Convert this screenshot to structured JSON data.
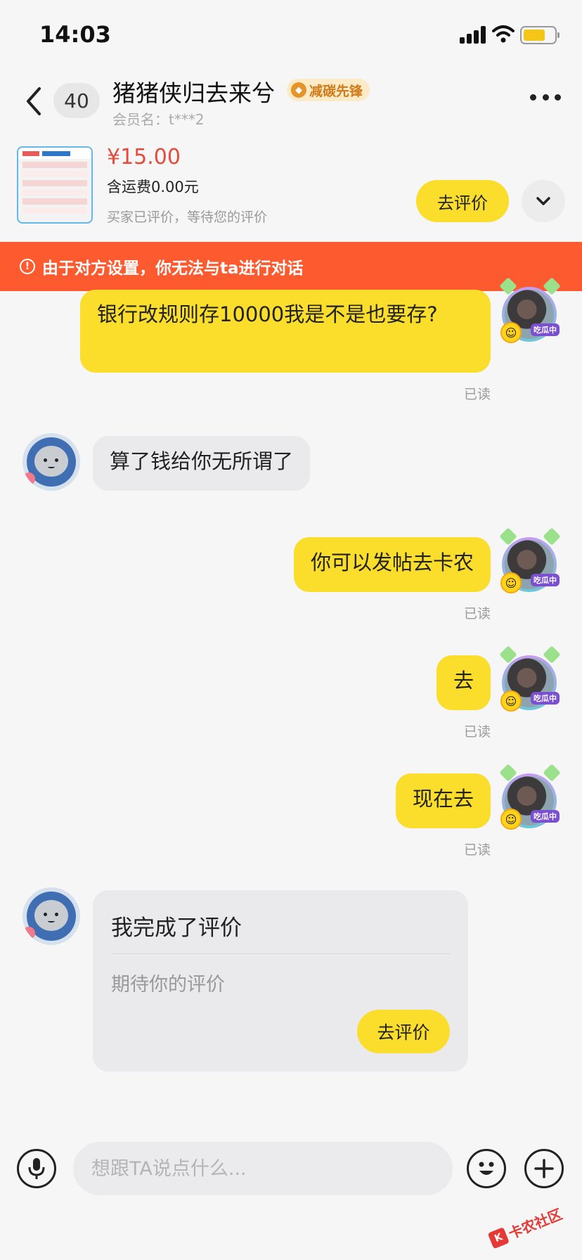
{
  "status_bar": {
    "time": "14:03"
  },
  "header": {
    "unread_count": "40",
    "nickname": "猪猪侠归去来兮",
    "medal": "减碳先锋",
    "member_label": "会员名：t***2"
  },
  "order": {
    "price": "¥15.00",
    "shipping": "含运费0.00元",
    "status": "买家已评价，等待您的评价",
    "review_button": "去评价"
  },
  "banner": {
    "text": "由于对方设置，你无法与ta进行对话"
  },
  "avatar_tag": "吃瓜中",
  "messages": [
    {
      "from": "me",
      "text": "银行改规则存10000我是不是也要存?",
      "status": "已读"
    },
    {
      "from": "ta",
      "text": "算了钱给你无所谓了"
    },
    {
      "from": "me",
      "text": "你可以发帖去卡农",
      "status": "已读"
    },
    {
      "from": "me",
      "text": "去",
      "status": "已读"
    },
    {
      "from": "me",
      "text": "现在去",
      "status": "已读"
    }
  ],
  "review_card": {
    "title": "我完成了评价",
    "subtitle": "期待你的评价",
    "button": "去评价"
  },
  "composer": {
    "placeholder": "想跟TA说点什么..."
  },
  "watermark": "卡农社区",
  "colors": {
    "accent_yellow": "#fbdd2c",
    "banner_orange": "#fe5a2f",
    "price_red": "#e54b3c"
  }
}
